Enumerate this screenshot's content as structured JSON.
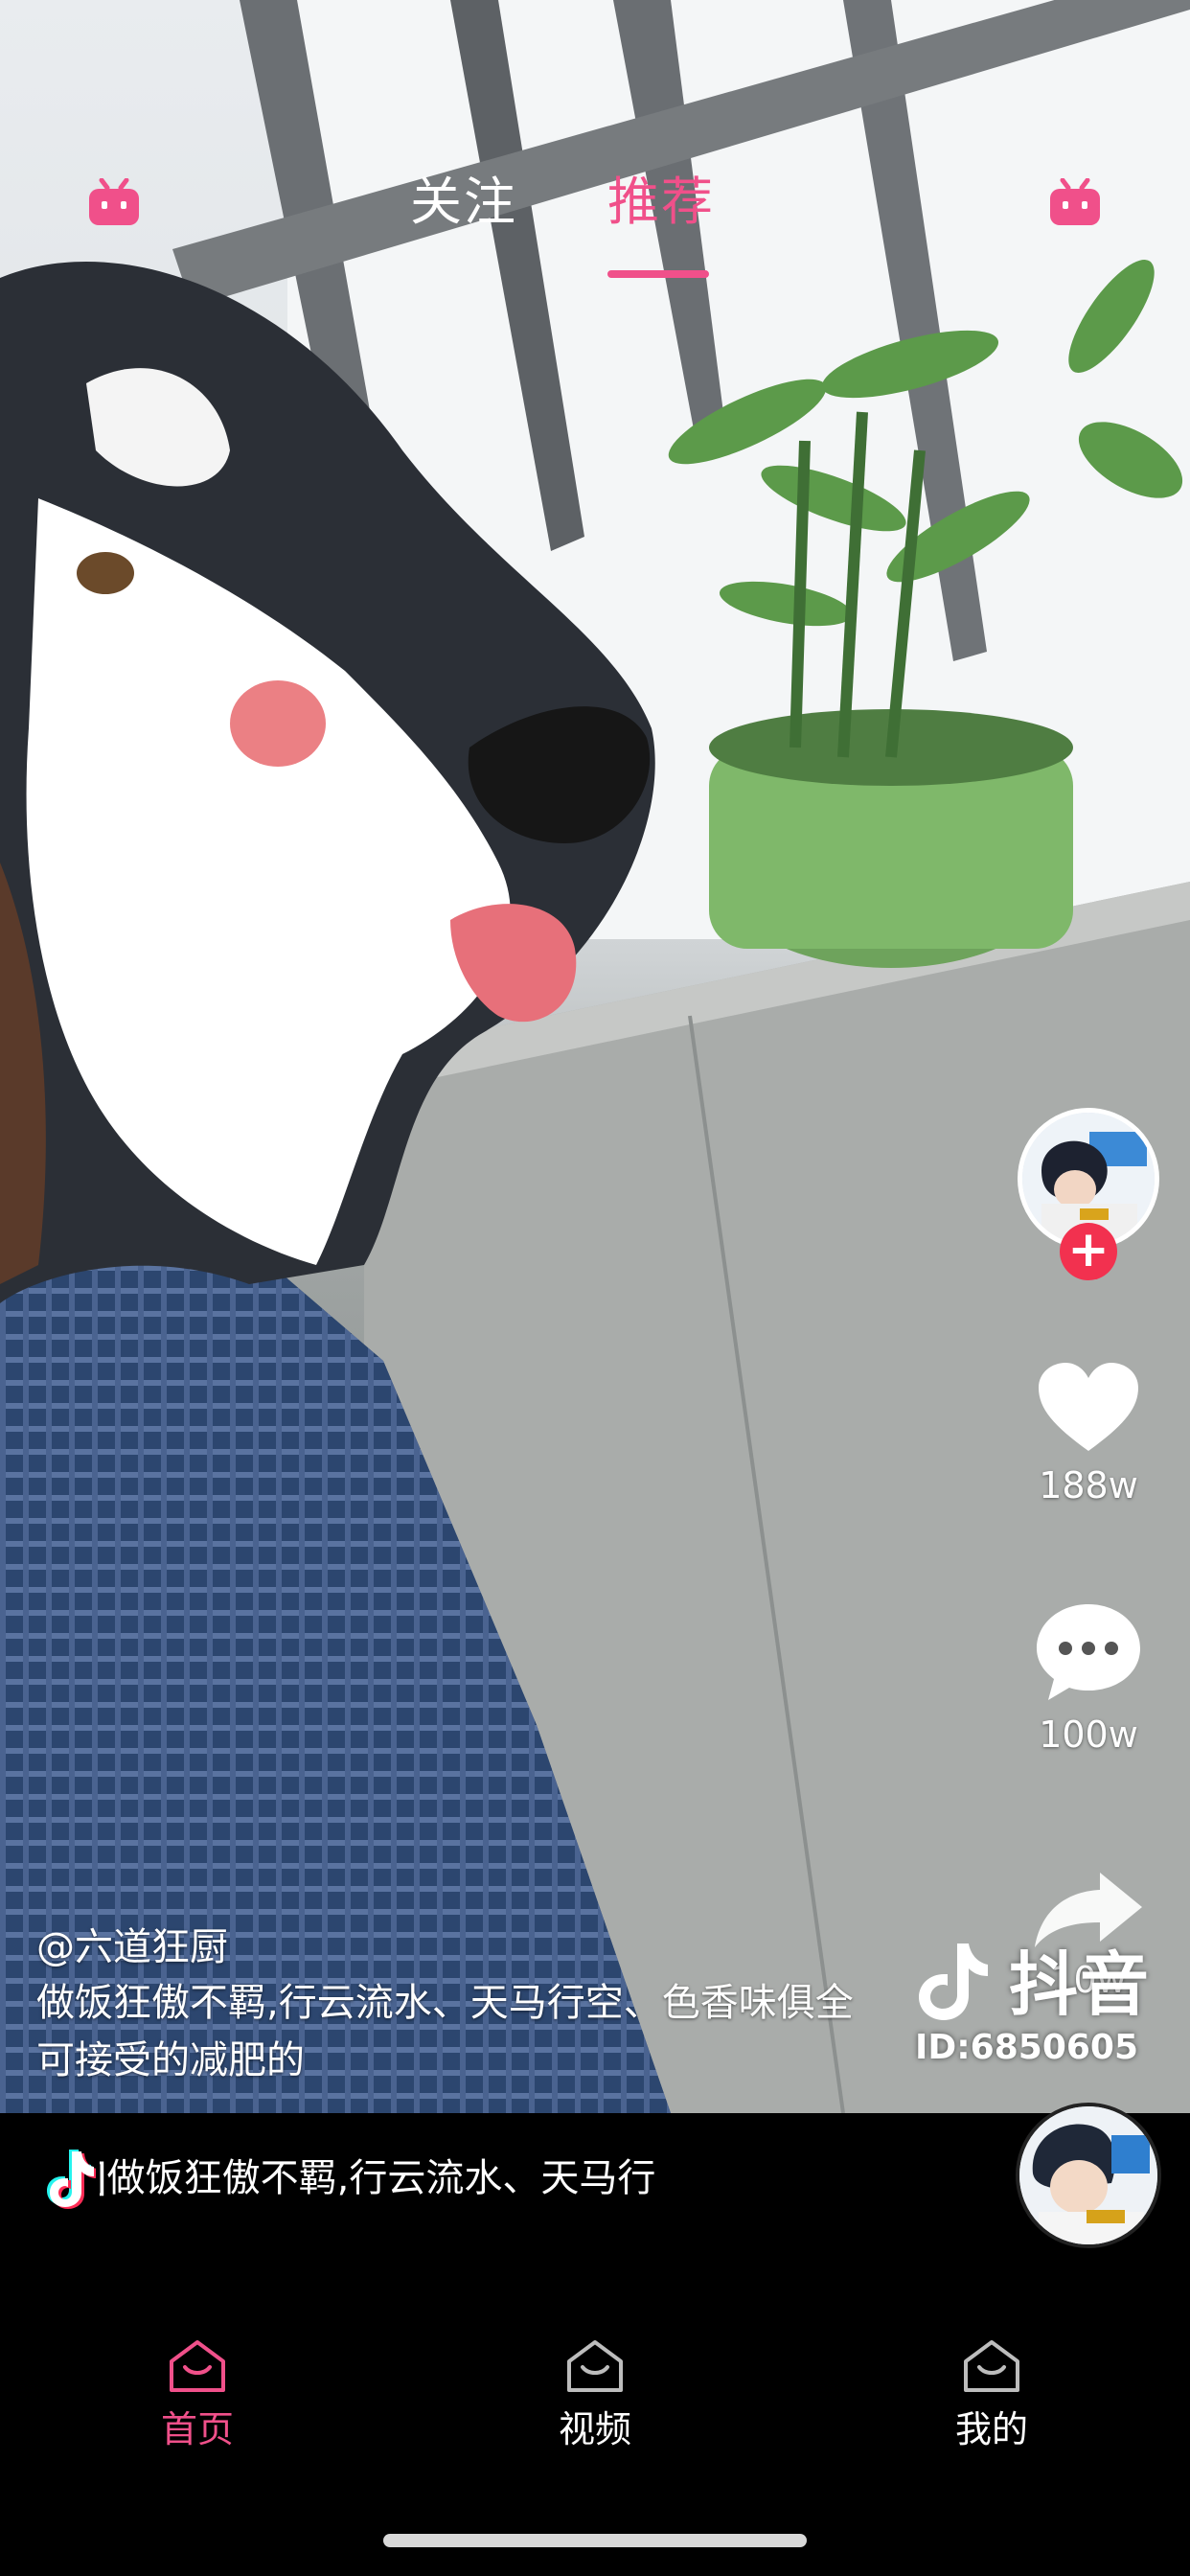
{
  "header": {
    "tabs": [
      {
        "label": "关注",
        "active": false
      },
      {
        "label": "推荐",
        "active": true
      }
    ],
    "left_icon": "tv-robot-icon",
    "right_icon": "tv-robot-icon"
  },
  "actions": {
    "likes": "188w",
    "comments": "100w",
    "shares": "10w"
  },
  "caption": {
    "author": "@六道狂厨",
    "line1": "做饭狂傲不羁,行云流水、天马行空、色香味俱全",
    "line2": "可接受的减肥的"
  },
  "watermark": {
    "brand": "抖音",
    "id": "ID:6850605"
  },
  "music": {
    "title": "]做饭狂傲不羁,行云流水、天马行"
  },
  "nav": {
    "items": [
      {
        "label": "首页",
        "active": true
      },
      {
        "label": "视频",
        "active": false
      },
      {
        "label": "我的",
        "active": false
      }
    ]
  },
  "colors": {
    "accent": "#f0508a",
    "follow_plus": "#f2314f",
    "background": "#000000"
  }
}
